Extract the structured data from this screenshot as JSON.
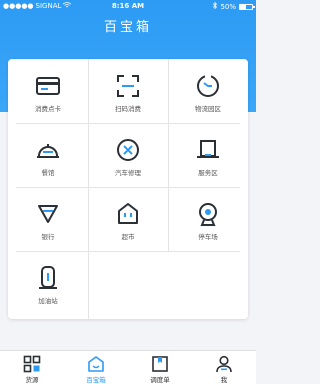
{
  "status_bar": {
    "carrier": "SIGNAL",
    "time": "8:16 AM",
    "battery": "50%",
    "battery_level": 0.5
  },
  "header": {
    "title": "百宝箱"
  },
  "grid": {
    "items": [
      {
        "label": "消费点卡",
        "icon": "card-icon"
      },
      {
        "label": "扫码消费",
        "icon": "scan-icon"
      },
      {
        "label": "物流园区",
        "icon": "logistics-icon"
      },
      {
        "label": "餐馆",
        "icon": "restaurant-icon"
      },
      {
        "label": "汽车修理",
        "icon": "car-repair-icon"
      },
      {
        "label": "服务区",
        "icon": "service-area-icon"
      },
      {
        "label": "银行",
        "icon": "bank-icon"
      },
      {
        "label": "超市",
        "icon": "supermarket-icon"
      },
      {
        "label": "停车场",
        "icon": "parking-icon"
      },
      {
        "label": "加油站",
        "icon": "gas-station-icon"
      }
    ]
  },
  "tabbar": {
    "tabs": [
      {
        "label": "货源",
        "icon": "goods-icon",
        "active": false
      },
      {
        "label": "百宝箱",
        "icon": "home-icon",
        "active": true
      },
      {
        "label": "调度单",
        "icon": "dispatch-icon",
        "active": false
      },
      {
        "label": "我",
        "icon": "user-icon",
        "active": false
      }
    ]
  },
  "colors": {
    "accent": "#2d9bf4",
    "icon_dark": "#2b2f36",
    "icon_blue": "#2d9bf4"
  }
}
